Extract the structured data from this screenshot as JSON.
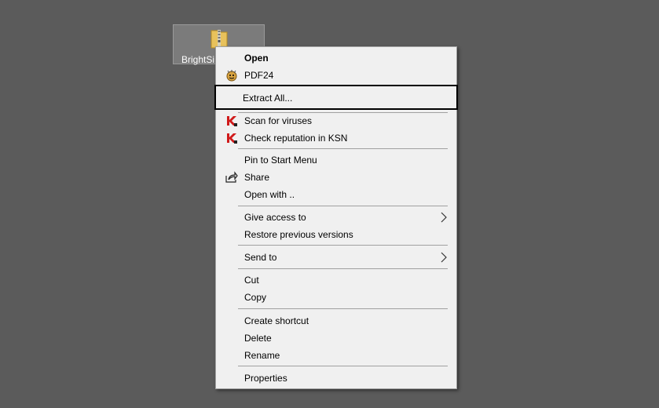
{
  "desktop": {
    "file_label": "BrightSi",
    "file_icon": "zip-folder-icon"
  },
  "menu": {
    "open": "Open",
    "pdf24": "PDF24",
    "extract_all": "Extract All...",
    "scan_viruses": "Scan for viruses",
    "check_reputation": "Check reputation in KSN",
    "pin_start": "Pin to Start Menu",
    "share": "Share",
    "open_with": "Open with ..",
    "give_access": "Give access to",
    "restore_versions": "Restore previous versions",
    "send_to": "Send to",
    "cut": "Cut",
    "copy": "Copy",
    "create_shortcut": "Create shortcut",
    "delete": "Delete",
    "rename": "Rename",
    "properties": "Properties"
  },
  "colors": {
    "desktop_bg": "#5b5b5b",
    "menu_bg": "#f0f0f0",
    "kaspersky_red": "#d01a1a"
  }
}
